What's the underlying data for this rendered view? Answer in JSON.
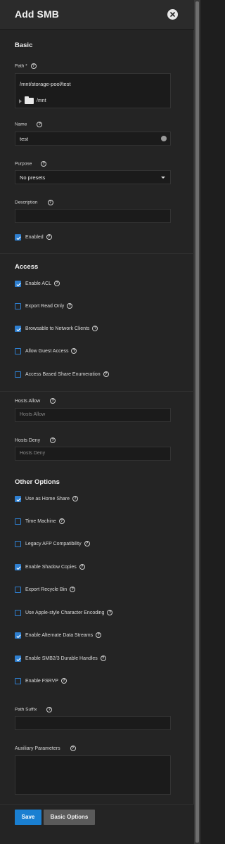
{
  "header": {
    "title": "Add SMB"
  },
  "basic": {
    "title": "Basic",
    "path": {
      "label": "Path *",
      "value": "/mnt/storage-pool/test",
      "tree_node": "/mnt"
    },
    "name": {
      "label": "Name",
      "value": "test"
    },
    "purpose": {
      "label": "Purpose",
      "value": "No presets"
    },
    "description": {
      "label": "Description",
      "value": ""
    },
    "enabled": {
      "label": "Enabled",
      "checked": true
    }
  },
  "access": {
    "title": "Access",
    "checkboxes": [
      {
        "label": "Enable ACL",
        "checked": true
      },
      {
        "label": "Export Read Only",
        "checked": false
      },
      {
        "label": "Browsable to Network Clients",
        "checked": true
      },
      {
        "label": "Allow Guest Access",
        "checked": false
      },
      {
        "label": "Access Based Share Enumeration",
        "checked": false
      }
    ],
    "hosts_allow": {
      "label": "Hosts Allow",
      "placeholder": "Hosts Allow"
    },
    "hosts_deny": {
      "label": "Hosts Deny",
      "placeholder": "Hosts Deny"
    }
  },
  "other": {
    "title": "Other Options",
    "checkboxes": [
      {
        "label": "Use as Home Share",
        "checked": true
      },
      {
        "label": "Time Machine",
        "checked": false
      },
      {
        "label": "Legacy AFP Compatibility",
        "checked": false
      },
      {
        "label": "Enable Shadow Copies",
        "checked": true
      },
      {
        "label": "Export Recycle Bin",
        "checked": false
      },
      {
        "label": "Use Apple-style Character Encoding",
        "checked": false
      },
      {
        "label": "Enable Alternate Data Streams",
        "checked": true
      },
      {
        "label": "Enable SMB2/3 Durable Handles",
        "checked": true
      },
      {
        "label": "Enable FSRVP",
        "checked": false
      }
    ],
    "path_suffix": {
      "label": "Path Suffix",
      "value": ""
    },
    "aux_params": {
      "label": "Auxiliary Parameters",
      "value": ""
    }
  },
  "footer": {
    "save_label": "Save",
    "basic_options_label": "Basic Options"
  },
  "help_glyph": "?",
  "colors": {
    "accent": "#1a7fd1",
    "panel": "#242424",
    "field": "#1b1b1b"
  }
}
